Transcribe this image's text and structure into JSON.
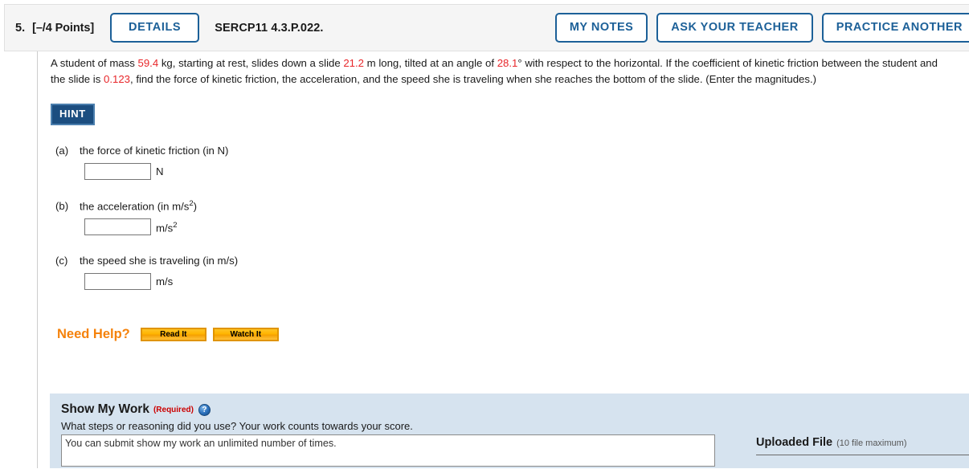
{
  "header": {
    "question_number": "5.",
    "points": "[–/4 Points]",
    "details_label": "DETAILS",
    "question_code": "SERCP11 4.3.P.022.",
    "my_notes_label": "MY NOTES",
    "ask_teacher_label": "ASK YOUR TEACHER",
    "practice_another_label": "PRACTICE ANOTHER",
    "accent_color": "#1c6098",
    "bar_background": "#f5f5f5"
  },
  "problem": {
    "text_1": "A student of mass ",
    "mass": "59.4",
    "text_2": " kg, starting at rest, slides down a slide ",
    "length": "21.2",
    "text_3": " m long, tilted at an angle of ",
    "angle": "28.1",
    "text_4": "° with respect to the horizontal. If the coefficient of kinetic friction between the student and the slide is ",
    "mu": "0.123",
    "text_5": ", find the force of kinetic friction, the acceleration, and the speed she is traveling when she reaches the bottom of the slide. (Enter the magnitudes.)",
    "value_color": "#e8262a"
  },
  "hint": {
    "label": "HINT",
    "background": "#1c4e80"
  },
  "parts": [
    {
      "letter": "(a)",
      "label": "the force of kinetic friction (in N)",
      "value": "",
      "unit": "N",
      "unit_sup": ""
    },
    {
      "letter": "(b)",
      "label_pre": "the acceleration (in m/s",
      "label_sup": "2",
      "label_post": ")",
      "value": "",
      "unit": "m/s",
      "unit_sup": "2"
    },
    {
      "letter": "(c)",
      "label": "the speed she is traveling (in m/s)",
      "value": "",
      "unit": "m/s",
      "unit_sup": ""
    }
  ],
  "need_help": {
    "label": "Need Help?",
    "read_it_label": "Read It",
    "watch_it_label": "Watch It",
    "label_color": "#f5820b",
    "button_color": "#ffb400"
  },
  "show_my_work": {
    "title": "Show My Work",
    "required": "(Required)",
    "help_icon_glyph": "?",
    "subtitle": "What steps or reasoning did you use? Your work counts towards your score.",
    "textarea_value": "You can submit show my work an unlimited number of times.",
    "textarea_placeholder": "",
    "uploaded_file_title": "Uploaded File",
    "uploaded_file_max": "(10 file maximum)",
    "panel_background": "#d6e3ef"
  }
}
